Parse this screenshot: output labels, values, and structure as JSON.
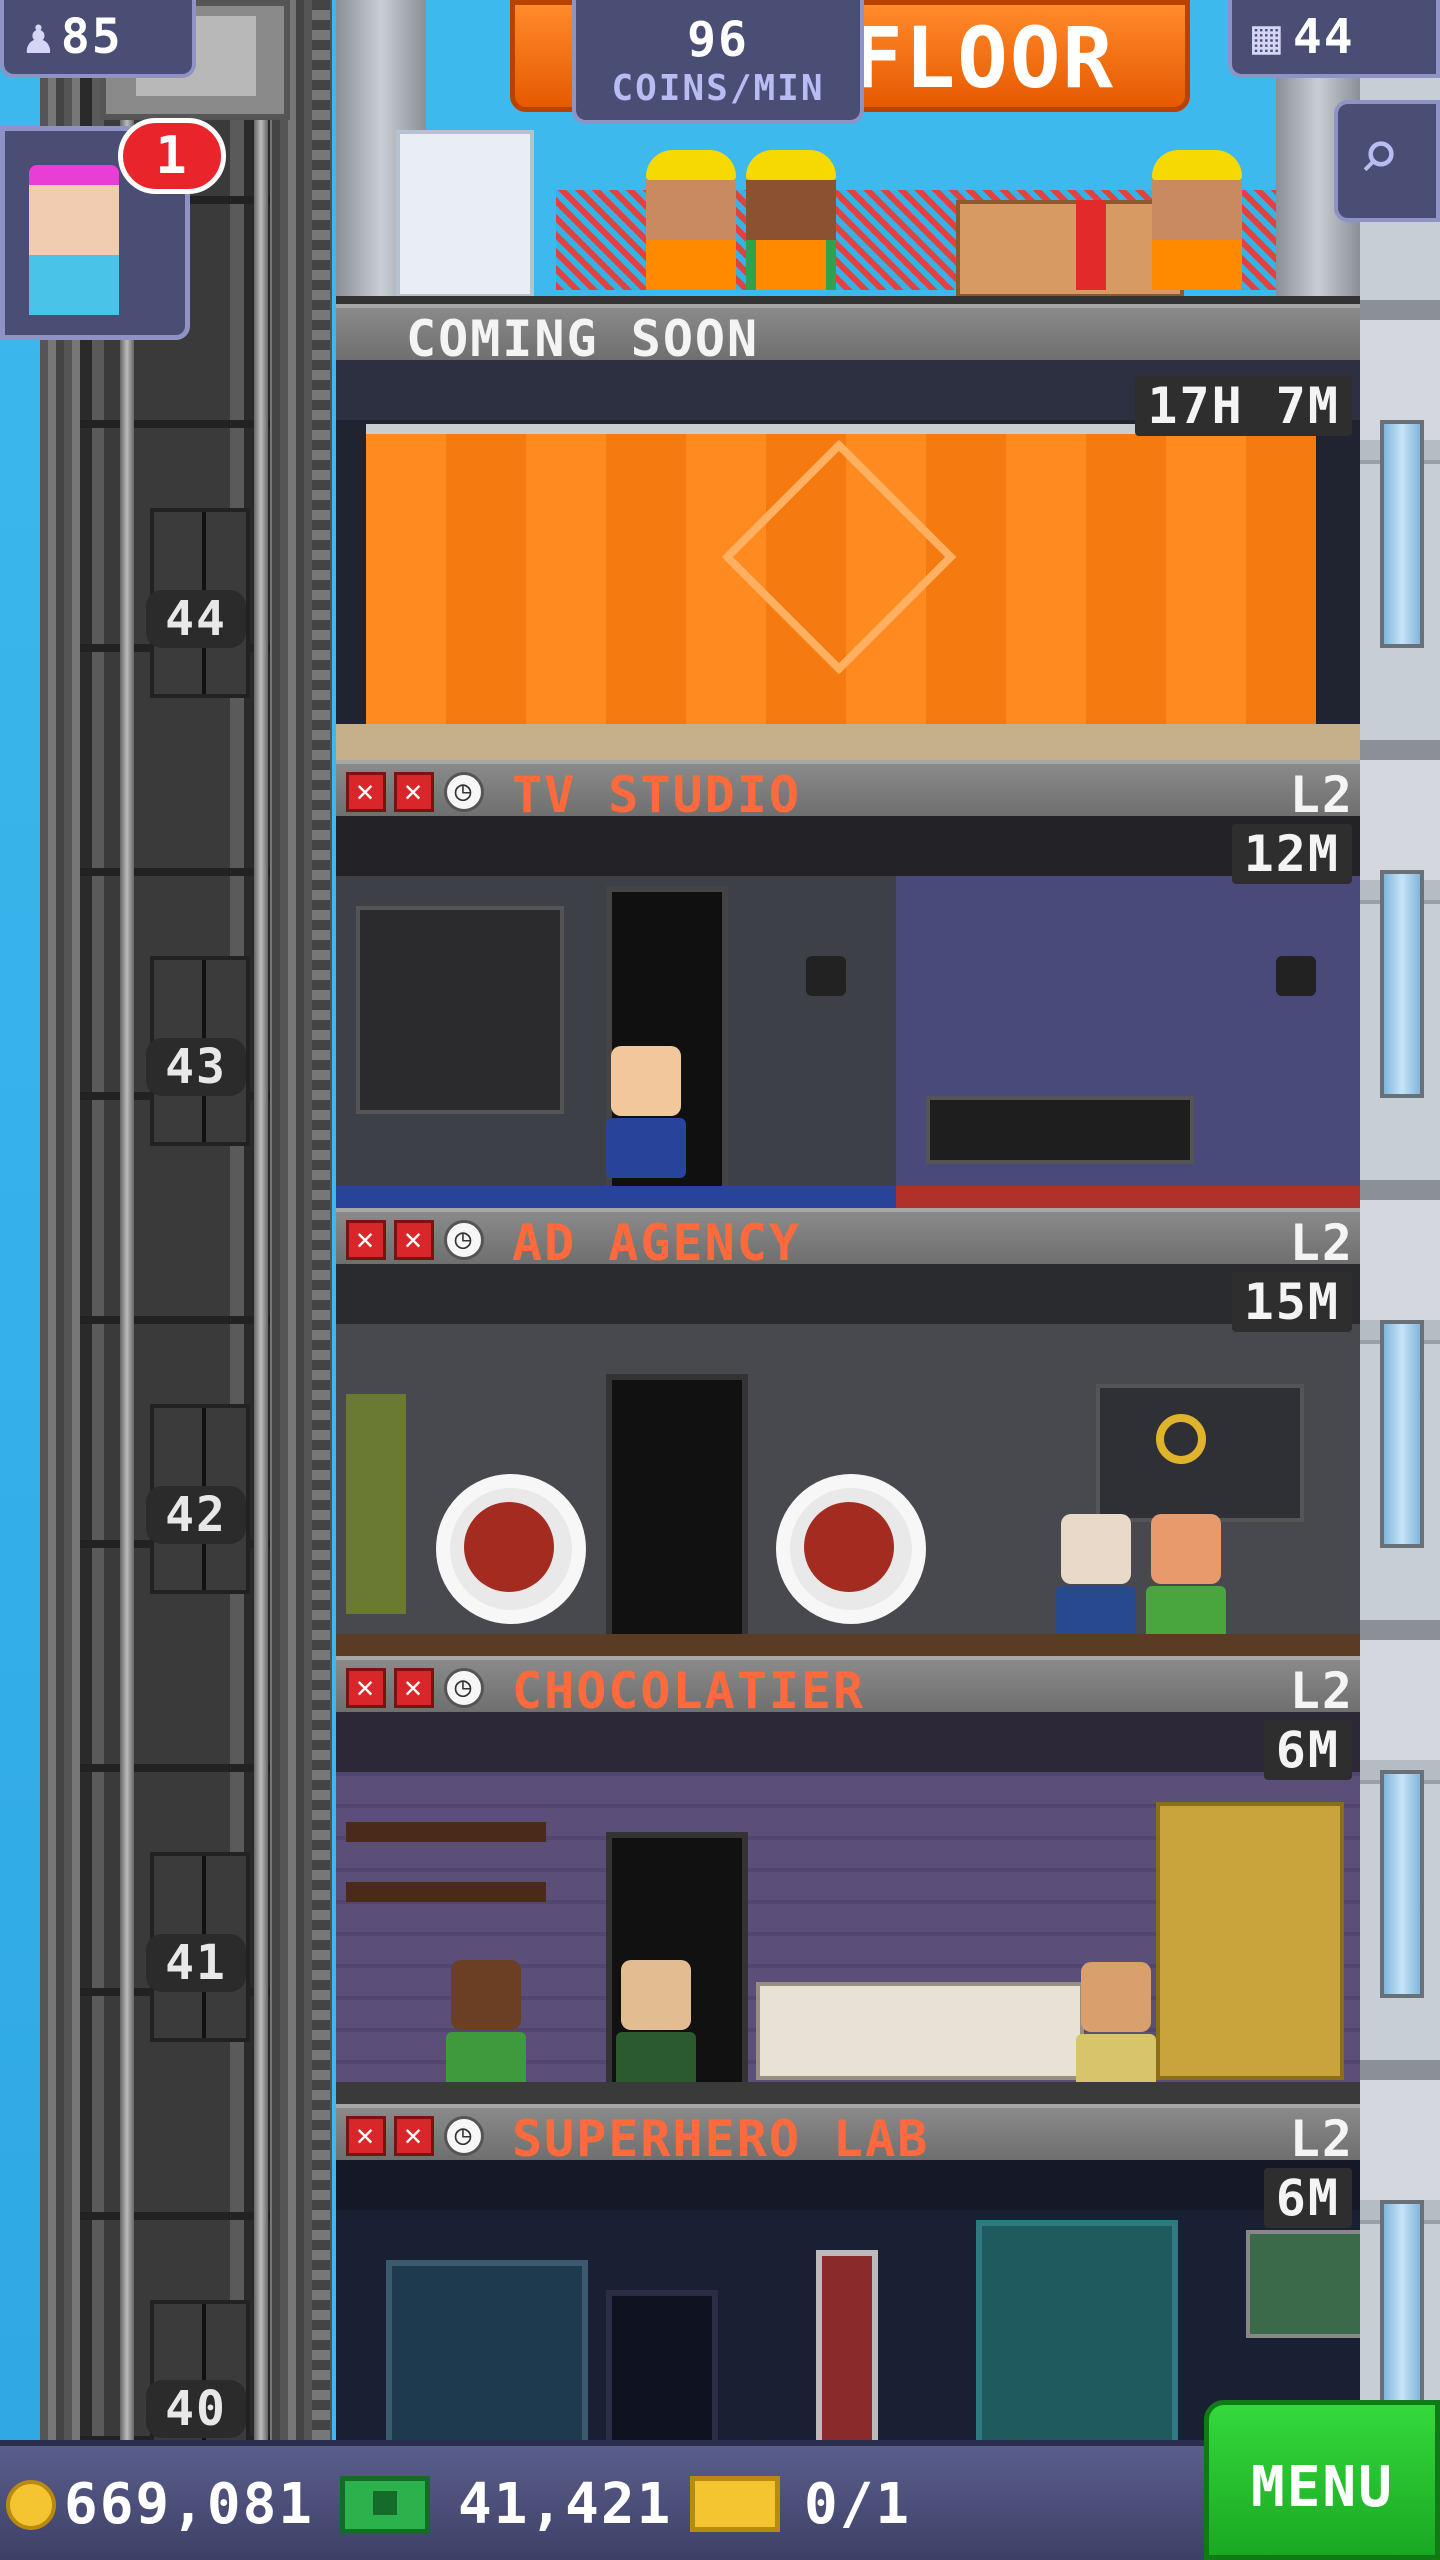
{
  "hud": {
    "population": "85",
    "coins_per_min_value": "96",
    "coins_per_min_label": "COINS/MIN",
    "build_floor_label": "FLOOR",
    "floor_count": "44",
    "notification_count": "1"
  },
  "shaft": {
    "floor_numbers": [
      "44",
      "43",
      "42",
      "41",
      "40"
    ]
  },
  "coming_soon": {
    "title": "COMING SOON",
    "timer": "17H 7M"
  },
  "floors": [
    {
      "name": "TV STUDIO",
      "level": "L2",
      "timer": "12M"
    },
    {
      "name": "AD AGENCY",
      "level": "L2",
      "timer": "15M"
    },
    {
      "name": "CHOCOLATIER",
      "level": "L2",
      "timer": "6M"
    },
    {
      "name": "SUPERHERO LAB",
      "level": "L2",
      "timer": "6M"
    }
  ],
  "bottom": {
    "coins": "669,081",
    "bux": "41,421",
    "tickets": "0/1",
    "menu_label": "MENU"
  },
  "colors": {
    "accent_orange": "#ff6a3d",
    "menu_green": "#22c12a",
    "hud_purple": "#4a4d74"
  }
}
